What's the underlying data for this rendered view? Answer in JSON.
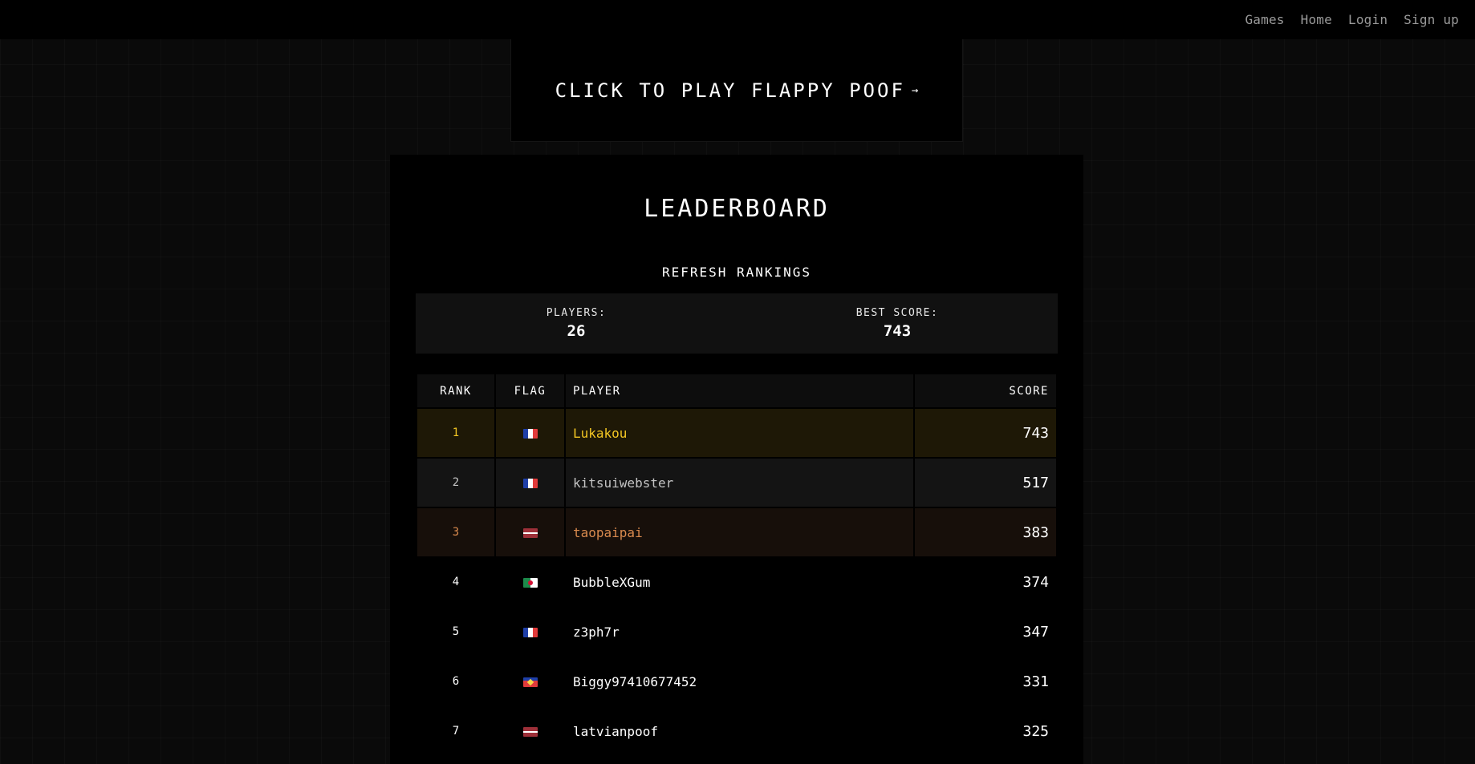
{
  "nav": {
    "links": [
      "Games",
      "Home",
      "Login",
      "Sign up"
    ]
  },
  "play": {
    "label": "CLICK TO PLAY FLAPPY POOF",
    "arrow": "→"
  },
  "leaderboard": {
    "title": "LEADERBOARD",
    "refresh_label": "REFRESH RANKINGS",
    "stats": {
      "players_label": "PLAYERS:",
      "players_value": "26",
      "best_label": "BEST SCORE:",
      "best_value": "743"
    },
    "columns": [
      "RANK",
      "FLAG",
      "PLAYER",
      "SCORE"
    ],
    "rows": [
      {
        "rank": "1",
        "flag": "fr",
        "player": "Lukakou",
        "score": "743"
      },
      {
        "rank": "2",
        "flag": "fr",
        "player": "kitsuiwebster",
        "score": "517"
      },
      {
        "rank": "3",
        "flag": "lv",
        "player": "taopaipai",
        "score": "383"
      },
      {
        "rank": "4",
        "flag": "dz",
        "player": "BubbleXGum",
        "score": "374"
      },
      {
        "rank": "5",
        "flag": "fr",
        "player": "z3ph7r",
        "score": "347"
      },
      {
        "rank": "6",
        "flag": "re",
        "player": "Biggy97410677452",
        "score": "331"
      },
      {
        "rank": "7",
        "flag": "lv",
        "player": "latvianpoof",
        "score": "325"
      }
    ]
  },
  "colors": {
    "gold": "#f3c623",
    "silver": "#c4c4c4",
    "bronze": "#d98a4e",
    "background": "#0a0a0a",
    "panel": "#000000"
  }
}
